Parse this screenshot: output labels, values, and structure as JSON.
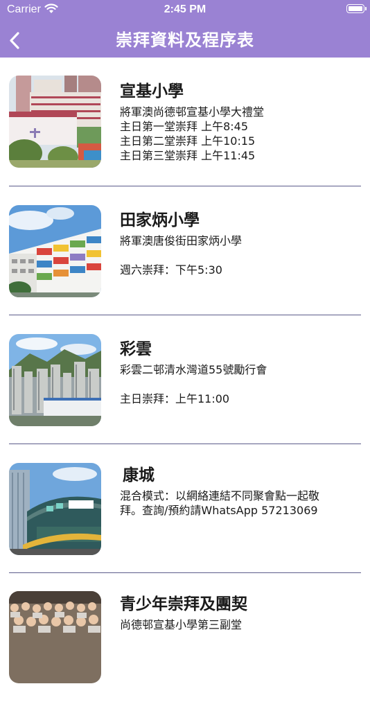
{
  "status_bar": {
    "carrier": "Carrier",
    "time": "2:45 PM"
  },
  "nav": {
    "title": "崇拜資料及程序表",
    "back_icon": "chevron-left-icon"
  },
  "colors": {
    "header": "#9a82d3",
    "divider": "#5b5b8a"
  },
  "venues": [
    {
      "name": "宣基小學",
      "lines": [
        "將軍澳尚德邨宣基小學大禮堂",
        "主日第一堂崇拜 上午8:45",
        "主日第二堂崇拜 上午10:15",
        "主日第三堂崇拜 上午11:45"
      ]
    },
    {
      "name": "田家炳小學",
      "lines": [
        "將軍澳唐俊街田家炳小學",
        "",
        "週六崇拜：下午5:30"
      ]
    },
    {
      "name": "彩雲",
      "lines": [
        "彩雲二邨清水灣道55號勵行會",
        "",
        "主日崇拜：上午11:00"
      ]
    },
    {
      "name": "康城",
      "lines": [
        "混合模式：以網絡連結不同聚會點一起敬",
        "拜。查詢/預約請WhatsApp 57213069"
      ]
    },
    {
      "name": "青少年崇拜及團契",
      "lines": [
        "尚德邨宣基小學第三副堂"
      ]
    }
  ]
}
